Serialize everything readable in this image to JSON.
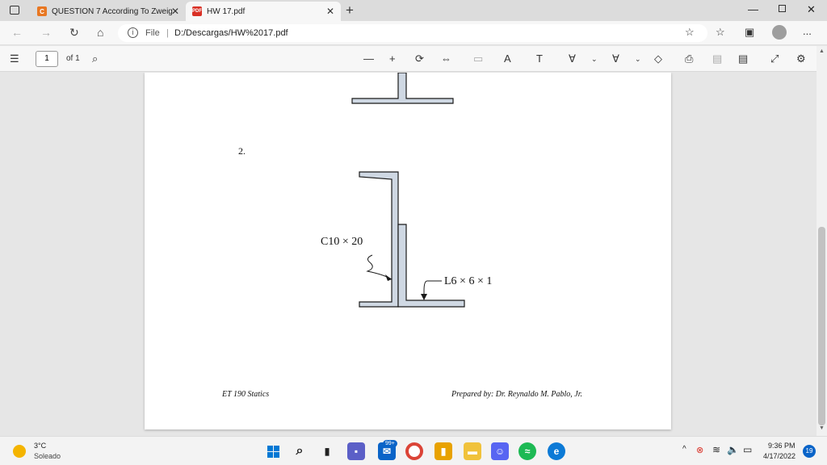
{
  "browser": {
    "tabs": [
      {
        "title": "QUESTION 7 According To Zweig",
        "favicon": "C",
        "active": false
      },
      {
        "title": "HW 17.pdf",
        "favicon": "PDF",
        "active": true
      }
    ],
    "new_tab_label": "+",
    "address": {
      "scheme_label": "File",
      "url": "D:/Descargas/HW%2017.pdf"
    },
    "more_label": "..."
  },
  "pdf_toolbar": {
    "page_current": "1",
    "page_total": "of 1"
  },
  "document": {
    "problem_number": "2.",
    "channel_label": "C10 × 20",
    "angle_label": "L6 × 6 × 1",
    "footer_left": "ET 190 Statics",
    "footer_right": "Prepared by: Dr. Reynaldo M. Pablo, Jr."
  },
  "taskbar": {
    "weather_temp": "3°C",
    "weather_desc": "Soleado",
    "mail_badge": "99+",
    "time": "9:36 PM",
    "date": "4/17/2022",
    "notification_count": "19"
  },
  "colors": {
    "shape_fill": "#cfd8e3",
    "shape_stroke": "#1a1a1a",
    "edge_accent": "#0c7ad6",
    "google_red": "#d93025"
  }
}
